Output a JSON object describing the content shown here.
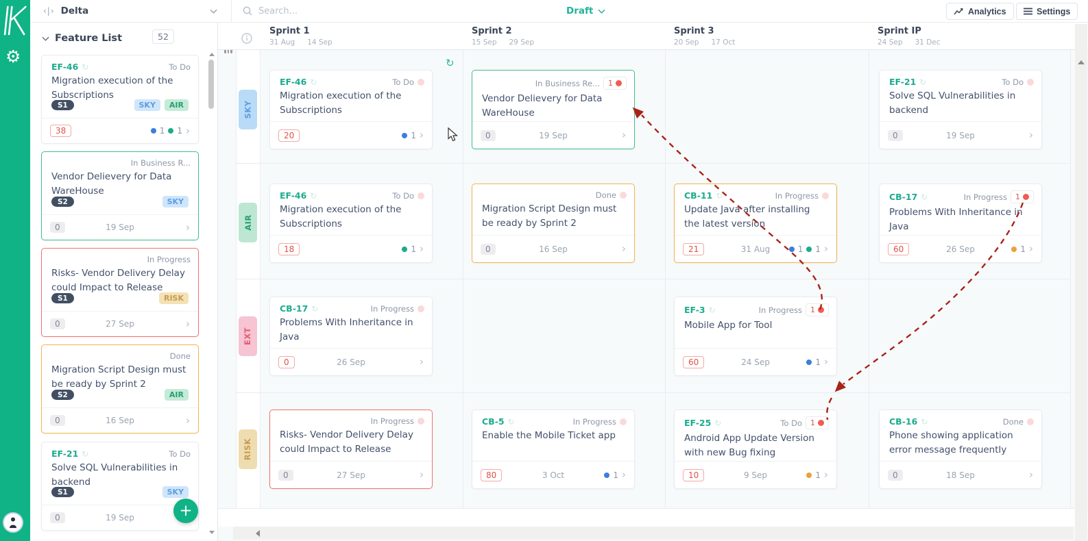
{
  "colors": {
    "brand_green": "#10b385",
    "accent_teal": "#1cab8e",
    "arrow_red": "#a92318",
    "alert_red": "#e0544a",
    "row_sky": "#b9dbf7",
    "row_air": "#bde7d3",
    "row_ext": "#f6c4d2",
    "row_risk": "#eeddb0"
  },
  "topbar": {
    "project": "Delta",
    "search_placeholder": "Search...",
    "mode": "Draft",
    "analytics_label": "Analytics",
    "settings_label": "Settings"
  },
  "panel": {
    "title": "Feature List",
    "count": "52",
    "cards": [
      {
        "id": "EF-46",
        "status": "To Do",
        "title": "Migration execution of the Subscriptions",
        "sprint": "S1",
        "tags": [
          "SKY",
          "AIR"
        ],
        "num": "38",
        "date": "",
        "dots": [
          {
            "color": "blue",
            "count": "1"
          },
          {
            "color": "green",
            "count": "1"
          }
        ]
      },
      {
        "id": "",
        "status": "In Business R...",
        "title": "Vendor Delievery for Data WareHouse",
        "sprint": "S2",
        "tags": [
          "SKY"
        ],
        "num": "0",
        "date": "19 Sep",
        "dots": []
      },
      {
        "id": "",
        "status": "In Progress",
        "title": "Risks- Vendor Delivery Delay could Impact to Release",
        "sprint": "S1",
        "tags": [
          "RISK"
        ],
        "num": "0",
        "date": "27 Sep",
        "dots": []
      },
      {
        "id": "",
        "status": "Done",
        "title": "Migration Script Design must be ready by Sprint 2",
        "sprint": "S2",
        "tags": [
          "AIR"
        ],
        "num": "0",
        "date": "16 Sep",
        "dots": []
      },
      {
        "id": "EF-21",
        "status": "To Do",
        "title": "Solve SQL Vulnerabilities in backend",
        "sprint": "S1",
        "tags": [
          "SKY"
        ],
        "num": "0",
        "date": "19 Sep",
        "dots": []
      }
    ]
  },
  "board": {
    "rows": [
      "SKY",
      "AIR",
      "EXT",
      "RISK"
    ],
    "sprints": [
      {
        "name": "Sprint 1",
        "start": "31 Aug",
        "end": "14 Sep"
      },
      {
        "name": "Sprint 2",
        "start": "15 Sep",
        "end": "29 Sep"
      },
      {
        "name": "Sprint 3",
        "start": "20 Sep",
        "end": "17 Oct"
      },
      {
        "name": "Sprint IP",
        "start": "24 Sep",
        "end": "31 Dec"
      }
    ],
    "cards": [
      {
        "id": "EF-46",
        "status": "To Do",
        "title": "Migration execution of the Subscriptions",
        "num": "20",
        "date": "",
        "badge": "",
        "dots": [
          {
            "color": "blue",
            "count": "1"
          }
        ]
      },
      {
        "id": "",
        "status": "In Business Re...",
        "title": "Vendor Delievery for Data WareHouse",
        "num": "0",
        "date": "19 Sep",
        "badge": "1",
        "dots": []
      },
      {
        "id": "EF-21",
        "status": "To Do",
        "title": "Solve SQL Vulnerabilities in backend",
        "num": "0",
        "date": "19 Sep",
        "badge": "",
        "dots": []
      },
      {
        "id": "EF-46",
        "status": "To Do",
        "title": "Migration execution of the Subscriptions",
        "num": "18",
        "date": "",
        "badge": "",
        "dots": [
          {
            "color": "green",
            "count": "1"
          }
        ]
      },
      {
        "id": "",
        "status": "Done",
        "title": "Migration Script Design must be ready by Sprint 2",
        "num": "0",
        "date": "16 Sep",
        "badge": "",
        "dots": []
      },
      {
        "id": "CB-11",
        "status": "In Progress",
        "title": "Update Java after installing the latest version",
        "num": "21",
        "date": "31 Aug",
        "badge": "",
        "dots": [
          {
            "color": "blue",
            "count": "1"
          },
          {
            "color": "green",
            "count": "1"
          }
        ]
      },
      {
        "id": "CB-17",
        "status": "In Progress",
        "title": "Problems With Inheritance in Java",
        "num": "60",
        "date": "26 Sep",
        "badge": "1",
        "dots": [
          {
            "color": "orange",
            "count": "1"
          }
        ]
      },
      {
        "id": "CB-17",
        "status": "In Progress",
        "title": "Problems With Inheritance in Java",
        "num": "0",
        "date": "26 Sep",
        "badge": "",
        "dots": []
      },
      {
        "id": "EF-3",
        "status": "In Progress",
        "title": "Mobile App for Tool",
        "num": "60",
        "date": "24 Sep",
        "badge": "1",
        "dots": [
          {
            "color": "blue",
            "count": "1"
          }
        ]
      },
      {
        "id": "",
        "status": "In Progress",
        "title": "Risks- Vendor Delivery Delay could Impact to Release",
        "num": "0",
        "date": "27 Sep",
        "badge": "",
        "dots": []
      },
      {
        "id": "CB-5",
        "status": "In Progress",
        "title": "Enable the Mobile Ticket app",
        "num": "80",
        "date": "3 Oct",
        "badge": "",
        "dots": [
          {
            "color": "blue",
            "count": "1"
          }
        ]
      },
      {
        "id": "EF-25",
        "status": "To Do",
        "title": "Android App Update Version with new Bug fixing",
        "num": "10",
        "date": "9 Sep",
        "badge": "1",
        "dots": [
          {
            "color": "orange",
            "count": "1"
          }
        ]
      },
      {
        "id": "CB-16",
        "status": "Done",
        "title": "Phone showing application error message frequently",
        "num": "0",
        "date": "18 Sep",
        "badge": "",
        "dots": []
      }
    ]
  }
}
